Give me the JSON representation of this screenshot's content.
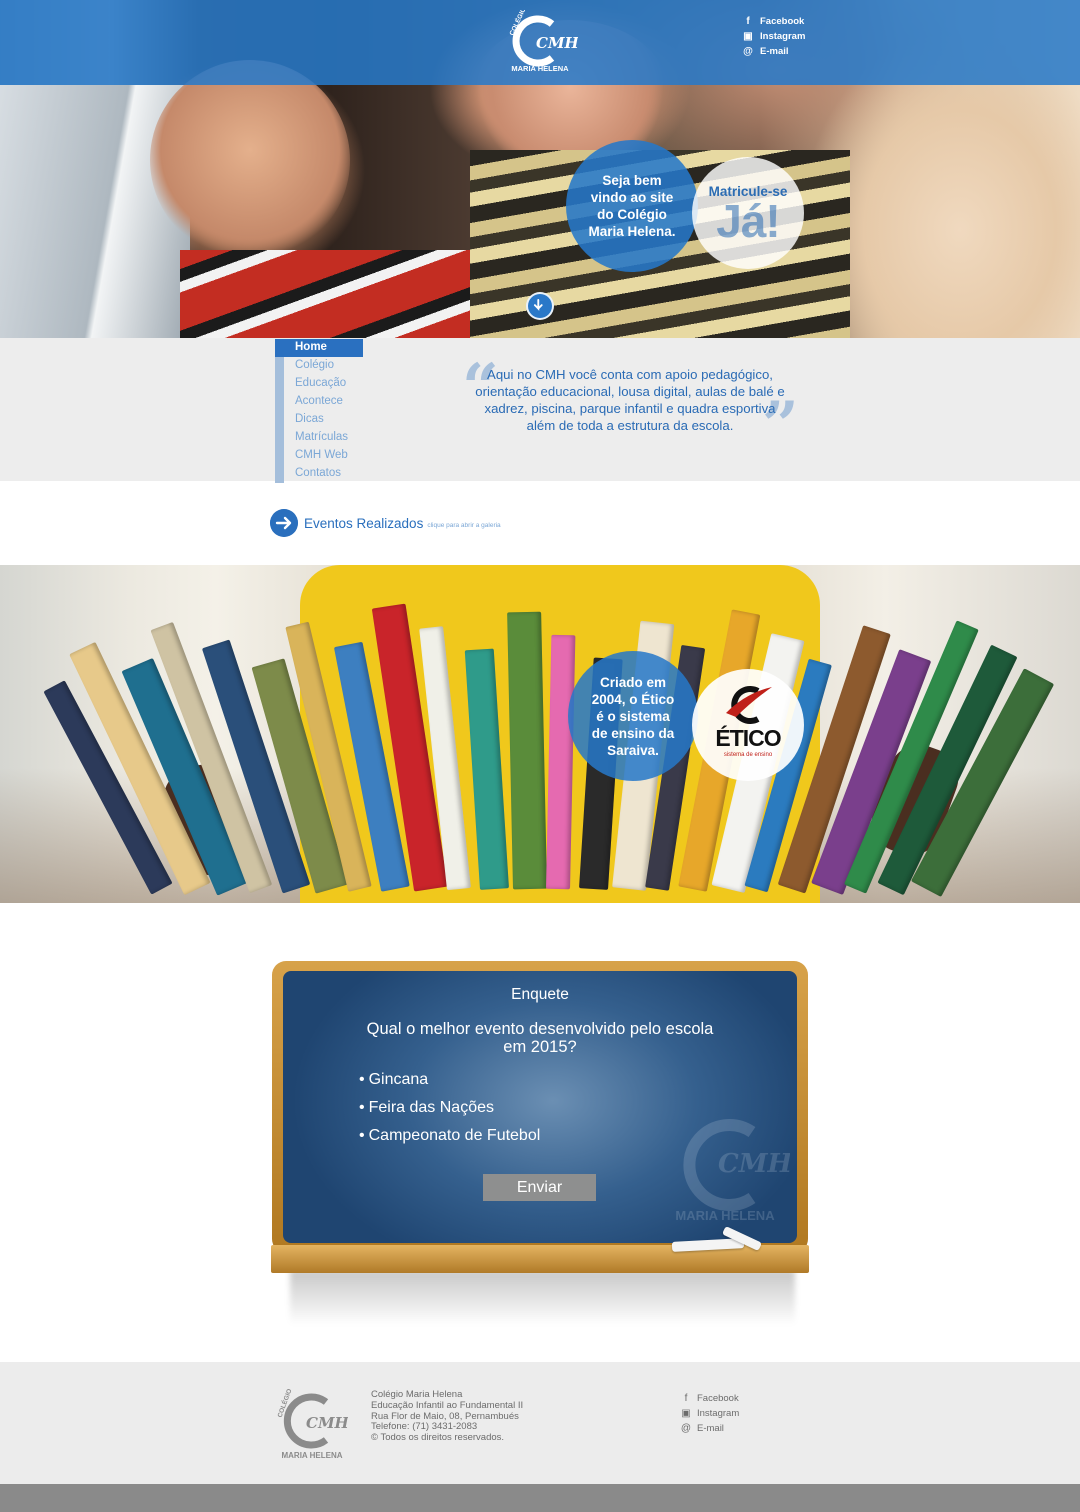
{
  "header": {
    "logo_top_text": "COLÉGIO",
    "logo_mark": "CMH",
    "logo_bottom_text": "MARIA HELENA",
    "social": [
      {
        "icon": "facebook-icon",
        "label": "Facebook"
      },
      {
        "icon": "instagram-icon",
        "label": "Instagram"
      },
      {
        "icon": "email-icon",
        "label": "E-mail"
      }
    ]
  },
  "hero": {
    "welcome": "Seja bem vindo ao site do Colégio Maria Helena.",
    "enroll_line1": "Matricule-se",
    "enroll_line2": "Já!",
    "scroll_icon": "arrow-down-icon"
  },
  "nav": {
    "items": [
      "Home",
      "Colégio",
      "Educação",
      "Acontece",
      "Dicas",
      "Matrículas",
      "CMH Web",
      "Contatos"
    ],
    "active": "Home"
  },
  "quote": {
    "text": "Aqui no CMH você conta com apoio pedagógico, orientação educacional, lousa digital, aulas de balé e xadrez, piscina, parque infantil e quadra esportiva além de toda a estrutura da escola."
  },
  "events": {
    "title": "Eventos Realizados",
    "subtitle": "clique para abrir a galeria",
    "icon": "arrow-right-icon"
  },
  "books_banner": {
    "text": "Criado em 2004, o Ético é o sistema de ensino da Saraiva.",
    "brand": "ÉTICO",
    "brand_tag": "sistema de ensino"
  },
  "poll": {
    "title": "Enquete",
    "question": "Qual o melhor evento desenvolvido pelo escola em 2015?",
    "options": [
      "Gincana",
      "Feira das Nações",
      "Campeonato de Futebol"
    ],
    "submit": "Enviar"
  },
  "footer": {
    "lines": [
      "Colégio Maria Helena",
      "Educação Infantil ao Fundamental II",
      "Rua Flor de Maio, 08, Pernambués",
      "Telefone: (71) 3431-2083",
      "© Todos os direitos reservados."
    ],
    "social": [
      {
        "icon": "facebook-icon",
        "label": "Facebook"
      },
      {
        "icon": "instagram-icon",
        "label": "Instagram"
      },
      {
        "icon": "email-icon",
        "label": "E-mail"
      }
    ]
  },
  "colors": {
    "primary_blue": "#2a70c0",
    "light_blue": "#7ba7d6",
    "board_blue": "#35608e",
    "footer_gray": "#ececec"
  }
}
